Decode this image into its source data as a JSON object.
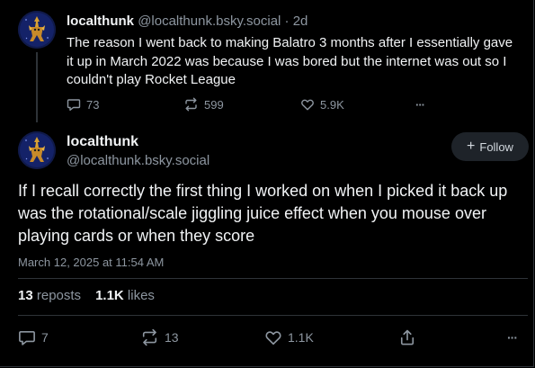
{
  "parent_post": {
    "display_name": "localthunk",
    "handle": "@localthunk.bsky.social",
    "separator": "·",
    "age": "2d",
    "text": "The reason I went back to making Balatro 3 months after I essentially gave it up in March 2022 was because I was bored but the internet was out so I couldn't play Rocket League",
    "replies": "73",
    "reposts": "599",
    "likes": "5.9K",
    "more": "···"
  },
  "main_post": {
    "display_name": "localthunk",
    "handle": "@localthunk.bsky.social",
    "follow_label": "Follow",
    "follow_icon": "+",
    "text": "If I recall correctly the first thing I worked on when I picked it back up was the rotational/scale jiggling juice effect when you mouse over playing cards or when they score",
    "timestamp": "March 12, 2025 at 11:54 AM",
    "stats": {
      "reposts_count": "13",
      "reposts_label": "reposts",
      "likes_count": "1.1K",
      "likes_label": "likes"
    },
    "replies": "7",
    "reposts": "13",
    "likes": "1.1K",
    "more": "···"
  },
  "icons": {
    "reply": "reply-icon",
    "repost": "repost-icon",
    "like": "heart-icon",
    "share": "share-icon",
    "more": "more-icon"
  },
  "colors": {
    "background": "#000000",
    "text": "#f1f3f5",
    "muted": "#8d96a0",
    "divider": "#2e3338",
    "follow_bg": "#1e2329"
  }
}
